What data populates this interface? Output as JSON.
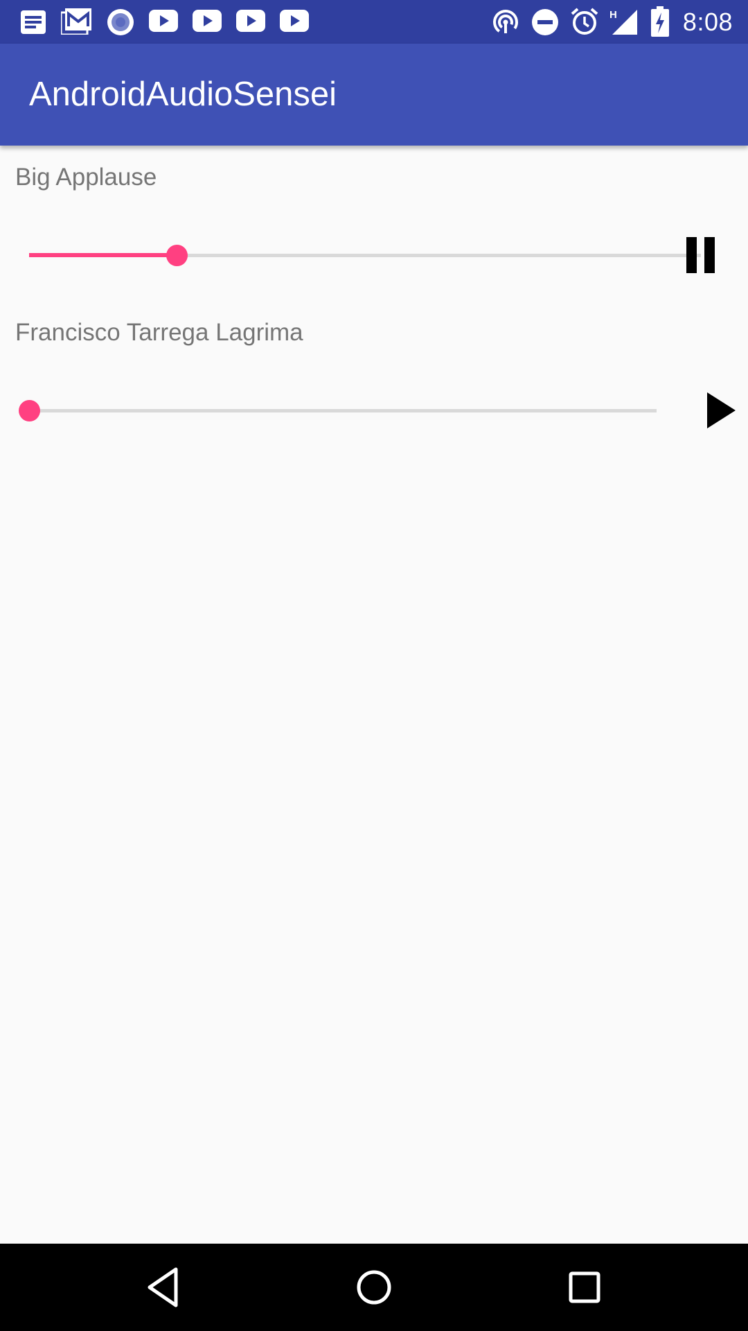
{
  "status_bar": {
    "time": "8:08",
    "background": "#303F9F",
    "notification_icons": [
      "notes-icon",
      "gmail-icon",
      "circle-app-icon",
      "youtube-icon",
      "youtube-icon",
      "youtube-icon",
      "youtube-icon"
    ],
    "system_icons": [
      "hotspot-icon",
      "do-not-disturb-icon",
      "alarm-icon",
      "signal-h-icon",
      "battery-charging-icon"
    ],
    "network_label": "H"
  },
  "app_bar": {
    "title": "AndroidAudioSensei",
    "background": "#3F51B5"
  },
  "tracks": [
    {
      "title": "Big Applause",
      "progress": 0.22,
      "state": "playing",
      "control_icon": "pause-icon"
    },
    {
      "title": "Francisco Tarrega Lagrima",
      "progress": 0.0,
      "state": "paused",
      "control_icon": "play-icon"
    }
  ],
  "colors": {
    "accent": "#FF4081",
    "track_text": "#757575",
    "rail": "#D9D9D9",
    "background": "#FAFAFA"
  },
  "nav_bar": {
    "buttons": [
      "back-icon",
      "home-icon",
      "recents-icon"
    ]
  }
}
